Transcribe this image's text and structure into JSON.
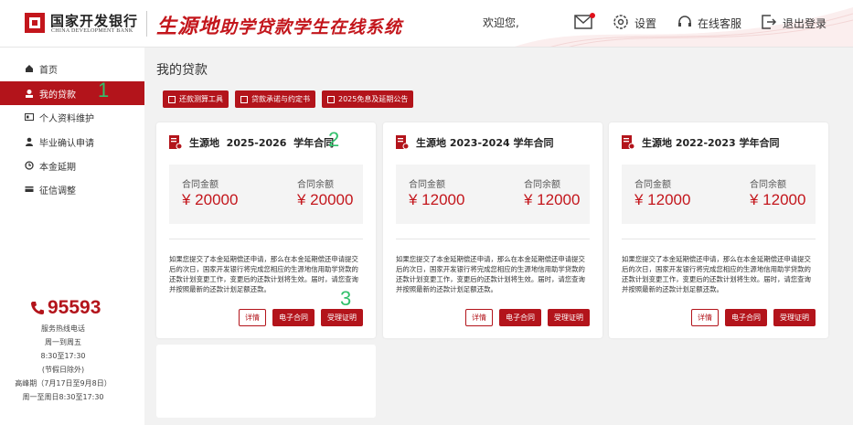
{
  "header": {
    "logo_cn": "国家开发银行",
    "logo_en": "CHINA DEVELOPMENT BANK",
    "system_title_prefix": "生源地",
    "system_title_rest": "助学贷款学生在线系统",
    "welcome": "欢迎您,",
    "settings": "设置",
    "service": "在线客服",
    "logout": "退出登录",
    "icons": {
      "mail": "mail-icon",
      "settings": "gear-icon",
      "service": "headset-icon",
      "logout": "logout-icon"
    },
    "accent_color": "#c3161c"
  },
  "sidebar": {
    "items": [
      {
        "label": "首页",
        "icon": "home-icon",
        "active": false
      },
      {
        "label": "我的贷款",
        "icon": "loan-icon",
        "active": true
      },
      {
        "label": "个人资料维护",
        "icon": "id-card-icon",
        "active": false
      },
      {
        "label": "毕业确认申请",
        "icon": "graduate-icon",
        "active": false
      },
      {
        "label": "本金延期",
        "icon": "clock-icon",
        "active": false
      },
      {
        "label": "征信调整",
        "icon": "credit-icon",
        "active": false
      }
    ],
    "annotation": "1",
    "hotline": "95593",
    "info": [
      "服务热线电话",
      "周一到周五",
      "8:30至17:30",
      "(节假日除外)",
      "高峰期（7月17日至9月8日）",
      "周一至周日8:30至17:30"
    ]
  },
  "main": {
    "title": "我的贷款",
    "tools": [
      "还款测算工具",
      "贷款承诺与约定书",
      "2025免息及延期公告"
    ],
    "cards": [
      {
        "title": "生源地  2025-2026  学年合同",
        "amount_label": "合同金额",
        "amount": "¥ 20000",
        "balance_label": "合同余额",
        "balance": "¥ 20000",
        "notice": "如果您提交了本金延期偿还申请，那么在本金延期偿还申请提交后的次日，国家开发银行将完成您相应的生源地信用助学贷款的还款计划变更工作，变更后的还款计划将生效。届时，请您查询并按照最新的还款计划足额还款。",
        "buttons": [
          "详情",
          "电子合同",
          "受理证明"
        ]
      },
      {
        "title": "生源地 2023-2024 学年合同",
        "amount_label": "合同金额",
        "amount": "¥ 12000",
        "balance_label": "合同余额",
        "balance": "¥ 12000",
        "notice": "如果您提交了本金延期偿还申请，那么在本金延期偿还申请提交后的次日，国家开发银行将完成您相应的生源地信用助学贷款的还款计划变更工作，变更后的还款计划将生效。届时，请您查询并按照最新的还款计划足额还款。",
        "buttons": [
          "详情",
          "电子合同",
          "受理证明"
        ]
      },
      {
        "title": "生源地 2022-2023 学年合同",
        "amount_label": "合同金额",
        "amount": "¥ 12000",
        "balance_label": "合同余额",
        "balance": "¥ 12000",
        "notice": "如果您提交了本金延期偿还申请，那么在本金延期偿还申请提交后的次日，国家开发银行将完成您相应的生源地信用助学贷款的还款计划变更工作，变更后的还款计划将生效。届时，请您查询并按照最新的还款计划足额还款。",
        "buttons": [
          "详情",
          "电子合同",
          "受理证明"
        ]
      }
    ],
    "annotations": [
      "2",
      "3"
    ]
  }
}
